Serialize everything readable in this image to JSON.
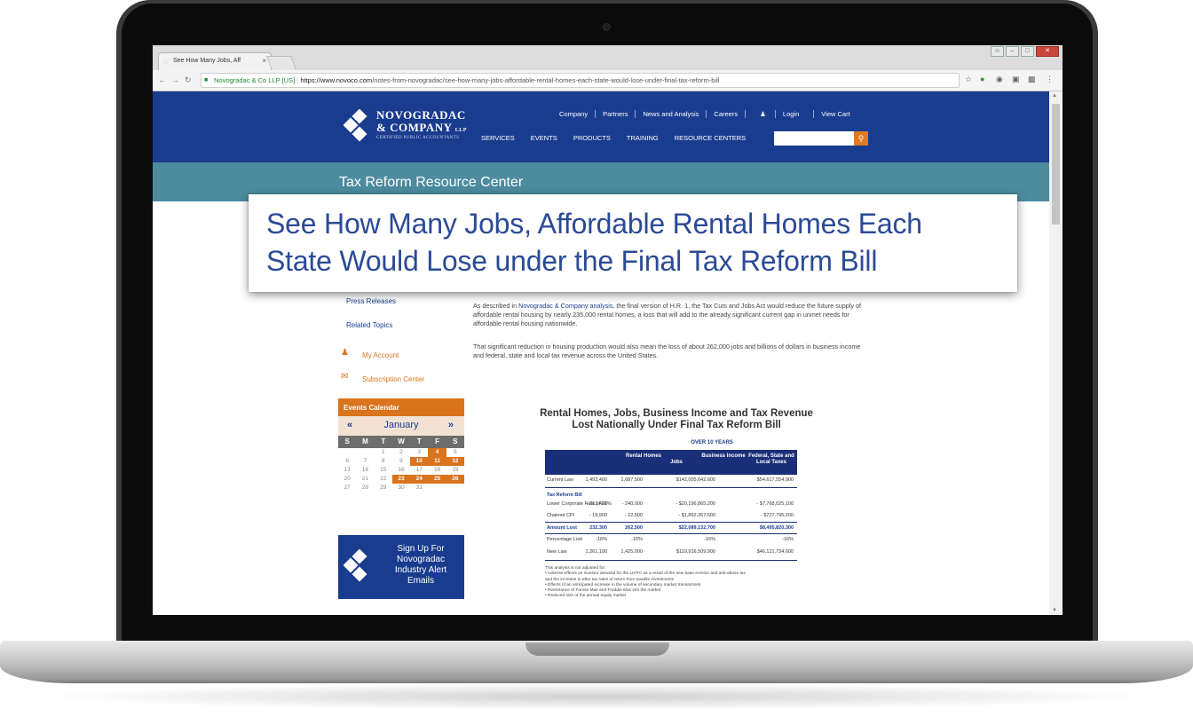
{
  "browser": {
    "tab_title": "See How Many Jobs, Aff",
    "tab_close": "×",
    "url_secure_label": "Novogradac & Co LLP [US]",
    "url_host": "https://www.novoco.com",
    "url_path": "/notes-from-novogradac/see-how-many-jobs-affordable-rental-homes-each-state-would-lose-under-final-tax-reform-bill"
  },
  "site": {
    "logo_line1": "NOVOGRADAC",
    "logo_line2": "& COMPANY",
    "logo_llp": "LLP",
    "logo_line3": "CERTIFIED PUBLIC ACCOUNTANTS",
    "top_nav": [
      "Company",
      "Partners",
      "News and Analysis",
      "Careers",
      "Login",
      "View Cart"
    ],
    "main_nav": [
      "SERVICES",
      "EVENTS",
      "PRODUCTS",
      "TRAINING",
      "RESOURCE CENTERS"
    ],
    "section_title": "Tax Reform Resource Center"
  },
  "callout": {
    "line1": "See How Many Jobs, Affordable Rental Homes Each",
    "line2": "State Would Lose under the Final Tax Reform Bill"
  },
  "sidebar": {
    "press_releases": "Press Releases",
    "related_topics": "Related Topics",
    "my_account": "My Account",
    "subscription_center": "Subscription Center",
    "events_calendar": "Events Calendar",
    "month": "January",
    "prev": "«",
    "next": "»",
    "dow": [
      "S",
      "M",
      "T",
      "W",
      "T",
      "F",
      "S"
    ],
    "signup_text": "Sign Up For Novogradac Industry Alert Emails"
  },
  "article": {
    "p1_before": "As described in ",
    "p1_link": "Novogradac & Company analysis",
    "p1_after": ", the final version of H.R. 1, the Tax Cuts and Jobs Act would reduce the future supply of affordable rental housing by nearly 235,000 rental homes, a loss that will add to the already significant current gap in unmet needs for affordable rental housing nationwide.",
    "p2": "That significant reduction in housing production would also mean the loss of about 262,000 jobs and billions of dollars in business income and federal, state and local tax revenue across the United States."
  },
  "table": {
    "title_line1": "Rental Homes, Jobs, Business Income and Tax Revenue",
    "title_line2": "Lost Nationally Under Final Tax Reform Bill",
    "over": "OVER 10 YEARS",
    "headers": [
      "Rental Homes",
      "Jobs",
      "Business Income",
      "Federal, State and Local Taxes"
    ],
    "current_law": [
      "Current Law",
      "1,493,400",
      "1,687,500",
      "$142,005,642,600",
      "$54,617,554,900"
    ],
    "section": "Tax Reform Bill",
    "row_corp": [
      "Lower Corporate Rate of 21%",
      "- 212,400",
      "- 240,000",
      "- $20,196,865,200",
      "- $7,768,025,100"
    ],
    "row_cpi": [
      "Chained CPI",
      "- 19,900",
      "- 22,500",
      "- $1,892,267,500",
      "- $727,795,200"
    ],
    "amount_lost": [
      "Amount Lost",
      "232,300",
      "262,500",
      "$22,089,132,700",
      "$8,495,820,300"
    ],
    "pct_lost": [
      "Percentage Lost",
      "-16%",
      "-16%",
      "-16%",
      "-16%"
    ],
    "new_law": [
      "New Law",
      "1,261,100",
      "1,425,000",
      "$119,916,509,900",
      "$46,121,734,600"
    ],
    "notes": [
      "This analysis is not adjusted for:",
      "•  Adverse effects on investor demand for the LIHTC as a result of the new base erosion and anti-abuse tax",
      "   and the increase in after tax rates of return from taxable investments",
      "•  Effects of an anticipated increase in the volume of secondary market transactions",
      "•  Reentrance of Fannie Mae and Freddie Mac into the market",
      "•  Reduced size of the annual equity market"
    ]
  },
  "colors": {
    "brand_blue": "#1a3c8f",
    "accent_orange": "#d9741c",
    "band_teal": "#4c8c9e"
  }
}
